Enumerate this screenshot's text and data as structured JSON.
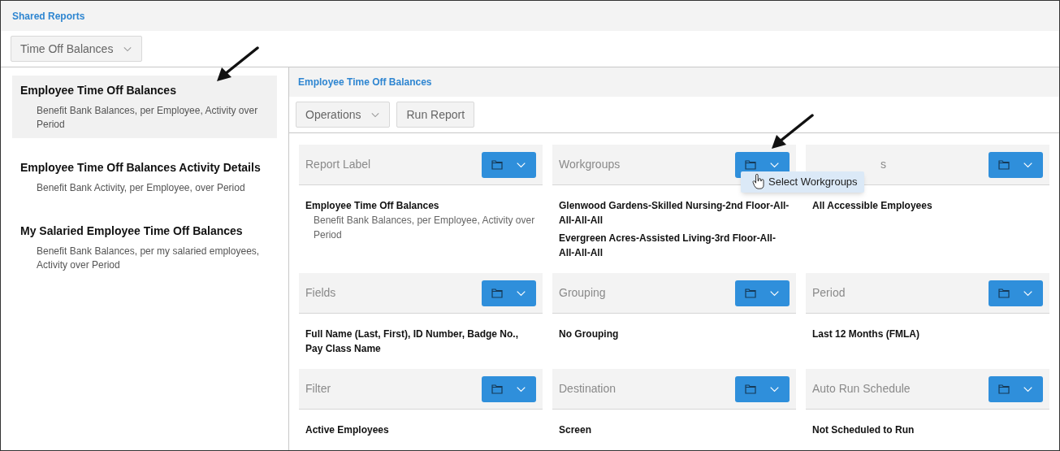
{
  "header": {
    "title": "Shared Reports"
  },
  "category_dropdown": {
    "value": "Time Off Balances"
  },
  "sidebar": {
    "items": [
      {
        "title": "Employee Time Off Balances",
        "description": "Benefit Bank Balances, per Employee, Activity over Period",
        "selected": true
      },
      {
        "title": "Employee Time Off Balances Activity Details",
        "description": "Benefit Bank Activity, per Employee, over Period",
        "selected": false
      },
      {
        "title": "My Salaried Employee Time Off Balances",
        "description": "Benefit Bank Balances, per my salaried employees, Activity over Period",
        "selected": false
      }
    ]
  },
  "report": {
    "title": "Employee Time Off Balances",
    "toolbar": [
      {
        "label": "Operations",
        "kind": "dropdown"
      },
      {
        "label": "Run Report",
        "kind": "button"
      }
    ],
    "cards": [
      {
        "title": "Report Label",
        "values": [
          "Employee Time Off Balances"
        ],
        "description": "Benefit Bank Balances, per Employee, Activity over Period"
      },
      {
        "title": "Workgroups",
        "values": [
          "Glenwood Gardens-Skilled Nursing-2nd Floor-All-All-All-All",
          "Evergreen Acres-Assisted Living-3rd Floor-All-All-All-All"
        ],
        "menu": {
          "items": [
            "Select Workgroups"
          ]
        }
      },
      {
        "title": "s",
        "values": [
          "All Accessible Employees"
        ]
      },
      {
        "title": "Fields",
        "values": [
          "Full Name (Last, First), ID Number, Badge No., Pay Class Name"
        ]
      },
      {
        "title": "Grouping",
        "values": [
          "No Grouping"
        ]
      },
      {
        "title": "Period",
        "values": [
          "Last 12 Months (FMLA)"
        ]
      },
      {
        "title": "Filter",
        "values": [
          "Active Employees"
        ]
      },
      {
        "title": "Destination",
        "values": [
          "Screen"
        ]
      },
      {
        "title": "Auto Run Schedule",
        "values": [
          "Not Scheduled to Run"
        ]
      }
    ]
  }
}
